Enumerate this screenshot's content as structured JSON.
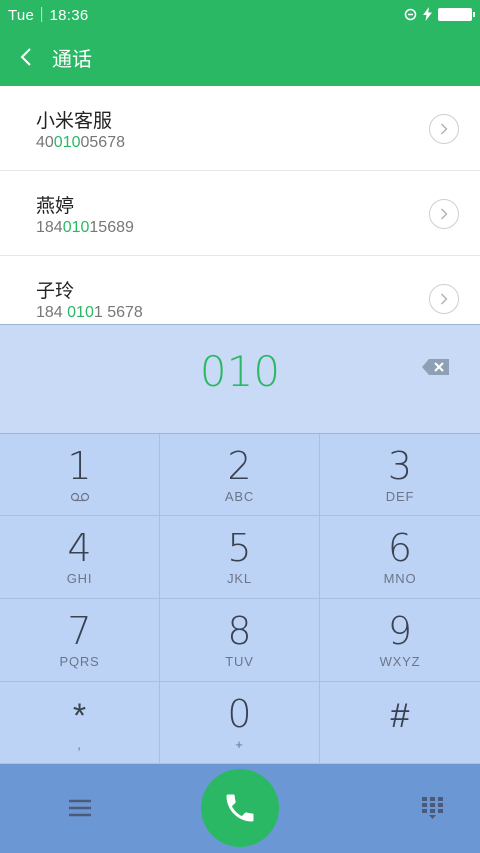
{
  "status_bar": {
    "time": "Tue｜18:36"
  },
  "app_bar": {
    "title": "通话"
  },
  "contacts": [
    {
      "name": "小米客服",
      "number_pre": "40",
      "number_match": "010",
      "number_post": "05678"
    },
    {
      "name": "燕婷",
      "number_pre": "184",
      "number_match": "010",
      "number_post": "15689"
    },
    {
      "name": "子玲",
      "number_pre": "184 ",
      "number_match": "010",
      "number_post": "1 5678"
    }
  ],
  "dial_display": {
    "digits": "010"
  },
  "keypad": [
    {
      "digit": "1",
      "letters": ""
    },
    {
      "digit": "2",
      "letters": "ABC"
    },
    {
      "digit": "3",
      "letters": "DEF"
    },
    {
      "digit": "4",
      "letters": "GHI"
    },
    {
      "digit": "5",
      "letters": "JKL"
    },
    {
      "digit": "6",
      "letters": "MNO"
    },
    {
      "digit": "7",
      "letters": "PQRS"
    },
    {
      "digit": "8",
      "letters": "TUV"
    },
    {
      "digit": "9",
      "letters": "WXYZ"
    },
    {
      "digit": "*",
      "letters": ","
    },
    {
      "digit": "0",
      "letters": "+"
    },
    {
      "digit": "#",
      "letters": ""
    }
  ],
  "colors": {
    "accent": "#2ab865",
    "keypad_bg": "#bcd3f6",
    "display_bg": "#c9daf7",
    "bottom_bar": "#6c97d5"
  },
  "icons": [
    "back-arrow-icon",
    "voicemail-icon",
    "backspace-icon",
    "menu-icon",
    "phone-icon",
    "dialpad-icon",
    "chevron-right-icon"
  ]
}
